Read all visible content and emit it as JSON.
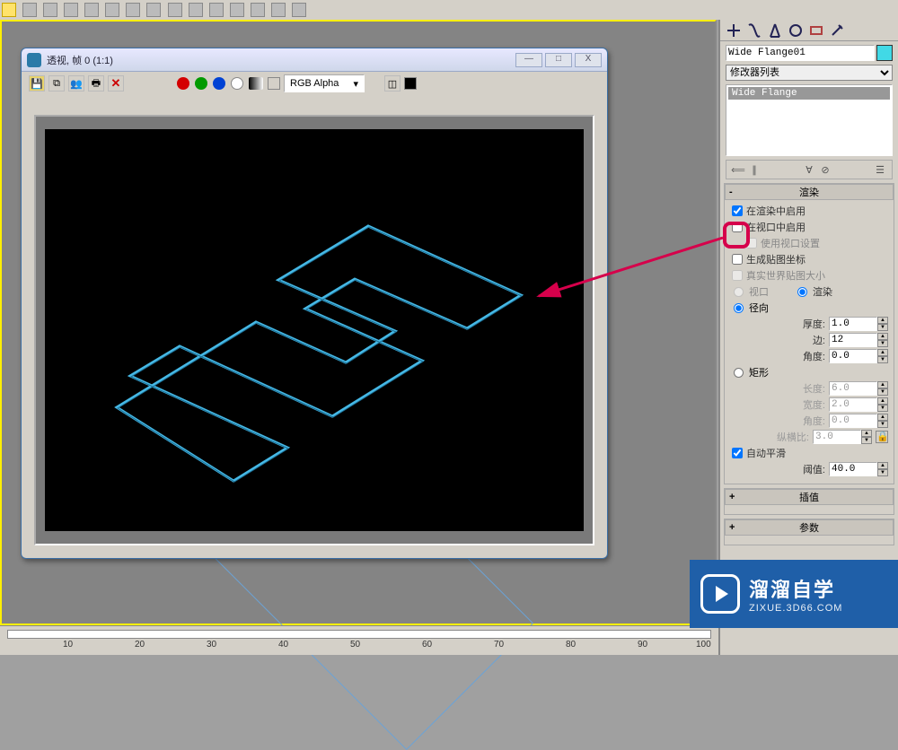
{
  "top_toolbar": {
    "icons": [
      "cursor",
      "select-region",
      "select-circle",
      "select-lasso",
      "select-window",
      "scale",
      "snap",
      "angle",
      "mirror",
      "align",
      "layers",
      "render",
      "material",
      "undo",
      "redo",
      "curve",
      "quick-render",
      "help",
      "schematic",
      "light",
      "camera",
      "grab"
    ]
  },
  "rfb": {
    "title": "透视, 帧 0 (1:1)",
    "window_buttons": {
      "min": "—",
      "max": "□",
      "close": "X"
    },
    "toolbar_icons": [
      "save-image",
      "copy-image",
      "search-view",
      "print",
      "clear"
    ],
    "channel_label": "RGB Alpha",
    "color_dots": [
      "#d40000",
      "#009a00",
      "#0042d4",
      "#ffffff"
    ],
    "extra_icons": [
      "clone-frame",
      "bg-color"
    ]
  },
  "panel": {
    "tab_icons": [
      "create",
      "modify",
      "hierarchy",
      "motion",
      "display",
      "utilities"
    ],
    "object_name": "Wide Flange01",
    "modifier_dropdown": "修改器列表",
    "stack_selected": "Wide Flange",
    "stack_btns": [
      "pin",
      "show-end",
      "make-unique",
      "remove",
      "configure"
    ],
    "rollouts": {
      "rendering": {
        "header": "渲染",
        "enable_render": "在渲染中启用",
        "enable_viewport": "在视口中启用",
        "use_vp_settings": "使用视口设置",
        "gen_map_coords": "生成贴图坐标",
        "real_world": "真实世界贴图大小",
        "radio_viewport": "视口",
        "radio_render": "渲染",
        "radial": "径向",
        "thickness_lbl": "厚度:",
        "thickness_val": "1.0",
        "sides_lbl": "边:",
        "sides_val": "12",
        "angle_lbl": "角度:",
        "angle_val": "0.0",
        "rect": "矩形",
        "length_lbl": "长度:",
        "length_val": "6.0",
        "width_lbl": "宽度:",
        "width_val": "2.0",
        "angle2_lbl": "角度:",
        "angle2_val": "0.0",
        "aspect_lbl": "纵横比:",
        "aspect_val": "3.0",
        "auto_smooth": "自动平滑",
        "threshold_lbl": "阈值:",
        "threshold_val": "40.0"
      },
      "interp": {
        "header": "插值"
      },
      "params": {
        "header": "参数"
      }
    }
  },
  "ruler_ticks": [
    {
      "pos": 70,
      "v": "10"
    },
    {
      "pos": 150,
      "v": "20"
    },
    {
      "pos": 230,
      "v": "30"
    },
    {
      "pos": 310,
      "v": "40"
    },
    {
      "pos": 390,
      "v": "50"
    },
    {
      "pos": 470,
      "v": "60"
    },
    {
      "pos": 550,
      "v": "70"
    },
    {
      "pos": 630,
      "v": "80"
    },
    {
      "pos": 710,
      "v": "90"
    },
    {
      "pos": 780,
      "v": "100"
    }
  ],
  "watermark": {
    "cn": "溜溜自学",
    "en": "ZIXUE.3D66.COM"
  }
}
